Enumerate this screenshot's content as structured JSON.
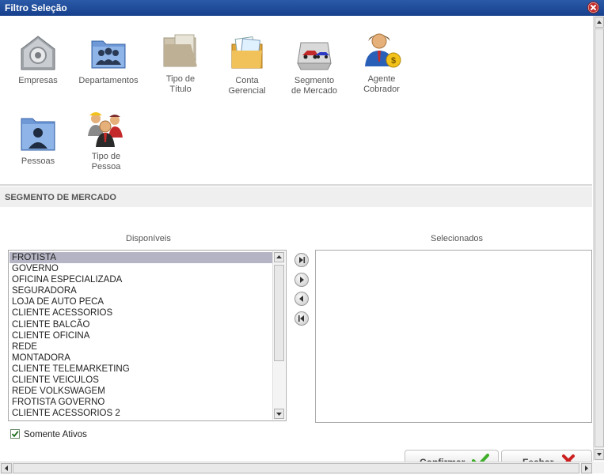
{
  "window": {
    "title": "Filtro Seleção"
  },
  "icons": [
    {
      "name": "empresas",
      "label": "Empresas",
      "icon": "safe-icon"
    },
    {
      "name": "departamentos",
      "label": "Departamentos",
      "icon": "people-folder-icon"
    },
    {
      "name": "tipo-de-titulo",
      "label": "Tipo de\nTítulo",
      "icon": "document-folder-icon"
    },
    {
      "name": "conta-gerencial",
      "label": "Conta\nGerencial",
      "icon": "papers-folder-icon"
    },
    {
      "name": "segmento-de-mercado",
      "label": "Segmento\nde Mercado",
      "icon": "cars-box-icon"
    },
    {
      "name": "agente-cobrador",
      "label": "Agente\nCobrador",
      "icon": "agent-money-icon"
    },
    {
      "name": "pessoas",
      "label": "Pessoas",
      "icon": "person-folder-icon"
    },
    {
      "name": "tipo-de-pessoa",
      "label": "Tipo de\nPessoa",
      "icon": "group-people-icon"
    }
  ],
  "section": {
    "title": "SEGMENTO DE MERCADO"
  },
  "available": {
    "header": "Disponíveis",
    "items": [
      "FROTISTA",
      "GOVERNO",
      "OFICINA ESPECIALIZADA",
      "SEGURADORA",
      "LOJA DE AUTO PECA",
      "CLIENTE ACESSORIOS",
      "CLIENTE BALCÃO",
      "CLIENTE OFICINA",
      "REDE",
      "MONTADORA",
      "CLIENTE TELEMARKETING",
      "CLIENTE VEICULOS",
      "REDE VOLKSWAGEM",
      "FROTISTA GOVERNO",
      "CLIENTE ACESSORIOS 2"
    ],
    "selected_item": "FROTISTA"
  },
  "selected": {
    "header": "Selecionados",
    "items": []
  },
  "move_buttons": [
    "move-all-right-icon",
    "move-right-icon",
    "move-left-icon",
    "move-all-left-icon"
  ],
  "checkbox": {
    "label": "Somente Ativos",
    "checked": true
  },
  "buttons": {
    "confirm": "Confirmar",
    "close": "Fechar"
  },
  "colors": {
    "titlebar": "#1d4a96",
    "selection": "#b4b4c4",
    "confirm_check": "#3fae2a",
    "close_x": "#cc1f1f"
  }
}
